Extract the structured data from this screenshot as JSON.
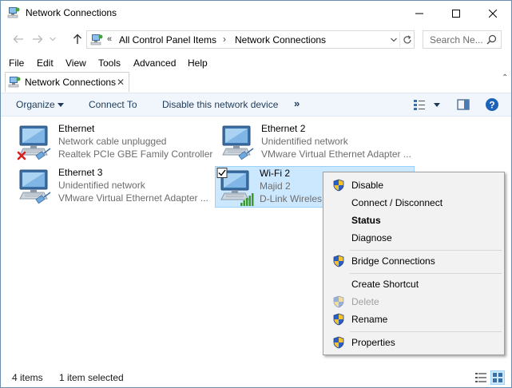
{
  "window": {
    "title": "Network Connections",
    "icon": "network-connections-icon"
  },
  "address": {
    "overflow": "«",
    "crumbs": [
      "All Control Panel Items",
      "Network Connections"
    ],
    "separator": "›",
    "search_placeholder": "Search Ne..."
  },
  "menu": [
    "File",
    "Edit",
    "View",
    "Tools",
    "Advanced",
    "Help"
  ],
  "tab": {
    "label": "Network Connections",
    "close": "✕"
  },
  "toolbar": {
    "organize": "Organize",
    "connect_to": "Connect To",
    "disable": "Disable this network device",
    "more": "»"
  },
  "connections": [
    {
      "name": "Ethernet",
      "status": "Network cable unplugged",
      "device": "Realtek PCIe GBE Family Controller",
      "badge": "red-x",
      "selected": false
    },
    {
      "name": "Ethernet 2",
      "status": "Unidentified network",
      "device": "VMware Virtual Ethernet Adapter ...",
      "badge": "cable",
      "selected": false
    },
    {
      "name": "Ethernet 3",
      "status": "Unidentified network",
      "device": "VMware Virtual Ethernet Adapter ...",
      "badge": "cable",
      "selected": false
    },
    {
      "name": "Wi-Fi 2",
      "status": "Majid  2",
      "device": "D-Link Wireles",
      "badge": "signal-bars",
      "selected": true
    }
  ],
  "context_menu": {
    "items": [
      {
        "label": "Disable",
        "shield": true
      },
      {
        "label": "Connect / Disconnect",
        "shield": false
      },
      {
        "label": "Status",
        "shield": false,
        "bold": true
      },
      {
        "label": "Diagnose",
        "shield": false
      },
      {
        "label": "Bridge Connections",
        "shield": true
      },
      {
        "label": "Create Shortcut",
        "shield": false
      },
      {
        "label": "Delete",
        "shield": true,
        "disabled": true
      },
      {
        "label": "Rename",
        "shield": true
      },
      {
        "label": "Properties",
        "shield": true
      }
    ]
  },
  "status": {
    "count": "4 items",
    "selected": "1 item selected"
  },
  "colors": {
    "selection_bg": "#cce8ff",
    "selection_border": "#99d1ff",
    "toolbar_bg": "#f0f6fc",
    "menu_bg": "#f2f2f2",
    "signal_green": "#3a9a2e",
    "error_red": "#d81e1e"
  }
}
